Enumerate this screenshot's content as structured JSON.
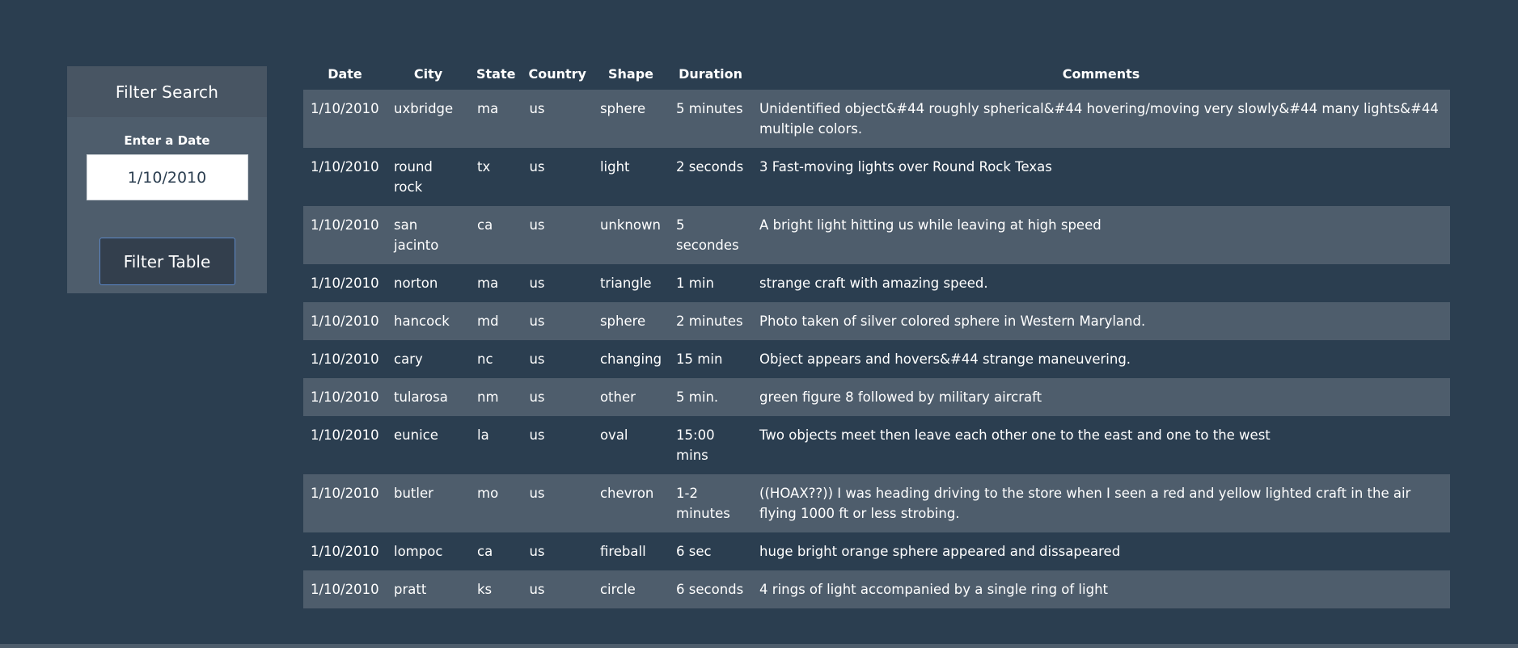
{
  "filter": {
    "heading": "Filter Search",
    "date_label": "Enter a Date",
    "date_value": "1/10/2010",
    "button_label": "Filter Table"
  },
  "table": {
    "headers": [
      "Date",
      "City",
      "State",
      "Country",
      "Shape",
      "Duration",
      "Comments"
    ],
    "rows": [
      [
        "1/10/2010",
        "uxbridge",
        "ma",
        "us",
        "sphere",
        "5 minutes",
        "Unidentified object&#44 roughly spherical&#44 hovering/moving very slowly&#44 many lights&#44 multiple colors."
      ],
      [
        "1/10/2010",
        "round rock",
        "tx",
        "us",
        "light",
        "2 seconds",
        "3 Fast-moving lights over Round Rock Texas"
      ],
      [
        "1/10/2010",
        "san jacinto",
        "ca",
        "us",
        "unknown",
        "5 secondes",
        "A bright light hitting us while leaving at high speed"
      ],
      [
        "1/10/2010",
        "norton",
        "ma",
        "us",
        "triangle",
        "1 min",
        "strange craft with amazing speed."
      ],
      [
        "1/10/2010",
        "hancock",
        "md",
        "us",
        "sphere",
        "2 minutes",
        "Photo taken of silver colored sphere in Western Maryland."
      ],
      [
        "1/10/2010",
        "cary",
        "nc",
        "us",
        "changing",
        "15 min",
        "Object appears and hovers&#44 strange maneuvering."
      ],
      [
        "1/10/2010",
        "tularosa",
        "nm",
        "us",
        "other",
        "5 min.",
        "green figure 8 followed by military aircraft"
      ],
      [
        "1/10/2010",
        "eunice",
        "la",
        "us",
        "oval",
        "15:00 mins",
        "Two objects meet then leave each other one to the east and one to the west"
      ],
      [
        "1/10/2010",
        "butler",
        "mo",
        "us",
        "chevron",
        "1-2 minutes",
        "((HOAX??)) I was heading driving to the store when I seen a red and yellow lighted craft in the air flying 1000 ft or less strobing."
      ],
      [
        "1/10/2010",
        "lompoc",
        "ca",
        "us",
        "fireball",
        "6 sec",
        "huge bright orange sphere appeared and dissapeared"
      ],
      [
        "1/10/2010",
        "pratt",
        "ks",
        "us",
        "circle",
        "6 seconds",
        "4 rings of light accompanied by a single ring of light"
      ]
    ]
  }
}
